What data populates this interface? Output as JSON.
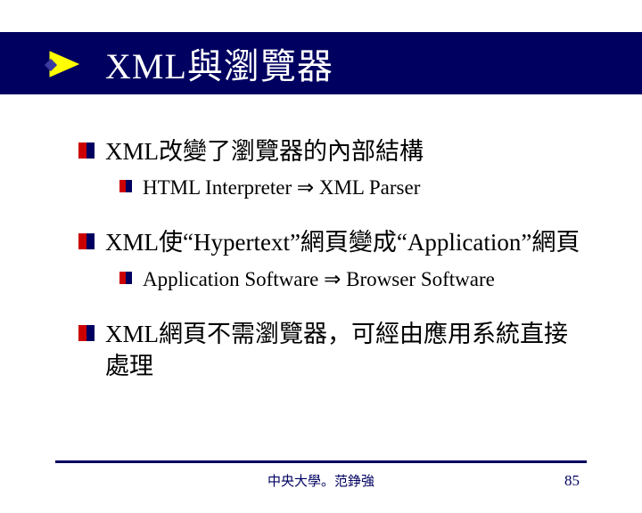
{
  "title": "XML與瀏覽器",
  "bullets": [
    {
      "text": "XML改變了瀏覽器的內部結構",
      "sub": "HTML Interpreter ⇒ XML Parser"
    },
    {
      "text": "XML使“Hypertext”網頁變成“Application”網頁",
      "sub": "Application Software ⇒ Browser Software"
    },
    {
      "text": "XML網頁不需瀏覽器，可經由應用系統直接處理",
      "sub": null
    }
  ],
  "footer": "中央大學。范錚強",
  "page": "85",
  "colors": {
    "navy": "#000060",
    "red": "#cc0000",
    "yellow": "#ffff00"
  }
}
